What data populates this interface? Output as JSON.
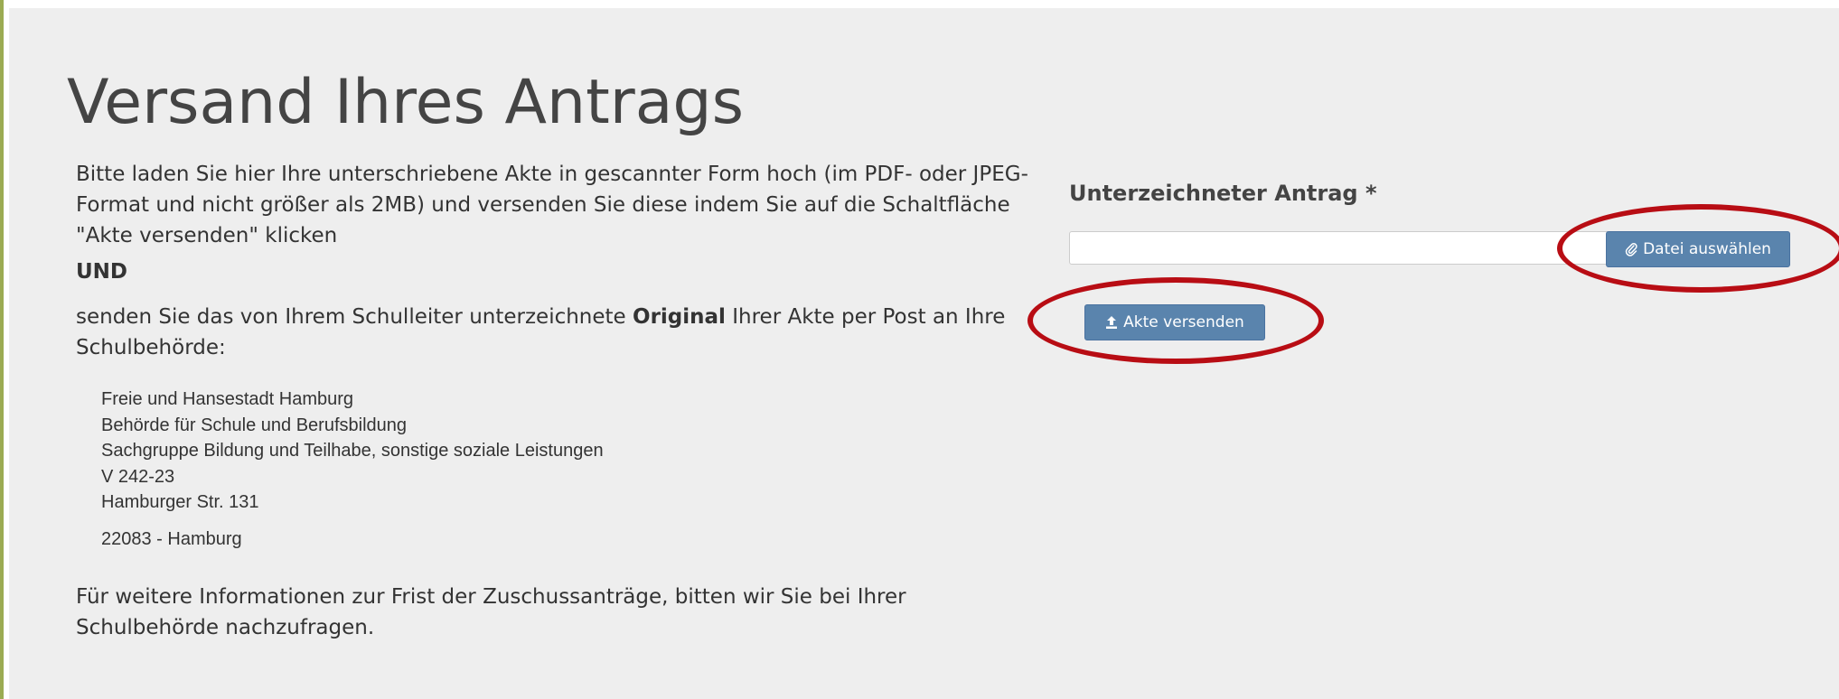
{
  "page": {
    "title": "Versand Ihres Antrags",
    "intro": "Bitte laden Sie hier Ihre unterschriebene Akte in gescannter Form hoch (im PDF- oder JPEG-Format und nicht größer als 2MB) und versenden Sie diese indem Sie auf die Schaltfläche \"Akte versenden\" klicken",
    "und": "UND",
    "post_text_before": "senden Sie das von Ihrem Schulleiter unterzeichnete ",
    "post_text_bold": "Original",
    "post_text_after": " Ihrer Akte per Post an Ihre Schulbehörde:",
    "address": {
      "line1": "Freie und Hansestadt Hamburg",
      "line2": "Behörde für Schule und Berufsbildung",
      "line3": "Sachgruppe Bildung und Teilhabe, sonstige soziale Leistungen",
      "line4": "V 242-23",
      "line5": "Hamburger Str. 131",
      "zip": "22083 - Hamburg"
    },
    "info": "Für weitere Informationen zur Frist der Zuschussanträge, bitten wir Sie bei Ihrer Schulbehörde nachzufragen."
  },
  "upload": {
    "label": "Unterzeichneter Antrag *",
    "file_value": "",
    "choose_file_label": "Datei auswählen",
    "choose_file_icon": "paperclip-icon",
    "send_label": "Akte versenden",
    "send_icon": "upload-icon"
  },
  "colors": {
    "button_bg": "#5a84ad",
    "highlight_ring": "#b80d14",
    "panel_bg": "#eeeeee",
    "accent_bar": "#9bab52"
  }
}
